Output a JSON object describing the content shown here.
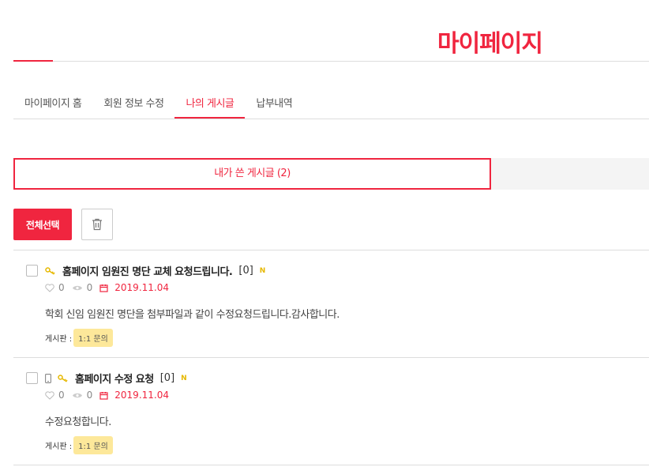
{
  "page": {
    "title": "마이페이지"
  },
  "tabs": [
    {
      "label": "마이페이지 홈"
    },
    {
      "label": "회원 정보 수정"
    },
    {
      "label": "나의 게시글"
    },
    {
      "label": "납부내역"
    }
  ],
  "subtab": {
    "label": "내가 쓴 게시글 (2)"
  },
  "toolbar": {
    "select_all_label": "전체선택"
  },
  "posts": [
    {
      "title": "홈페이지 임원진 명단 교체 요청드립니다.",
      "comments": "[0]",
      "new_badge": "N",
      "likes": "0",
      "views": "0",
      "date": "2019.11.04",
      "body": "학회 신임 임원진 명단을 첨부파일과 같이 수정요청드립니다.감사합니다.",
      "board_label": "게시판 :",
      "board_name": "1:1 문의"
    },
    {
      "title": "홈페이지 수정 요청",
      "comments": "[0]",
      "new_badge": "N",
      "likes": "0",
      "views": "0",
      "date": "2019.11.04",
      "body": "수정요청합니다.",
      "board_label": "게시판 :",
      "board_name": "1:1 문의"
    }
  ],
  "colors": {
    "accent": "#f0253f",
    "badge": "#fde89a",
    "key_icon": "#e6b800"
  }
}
